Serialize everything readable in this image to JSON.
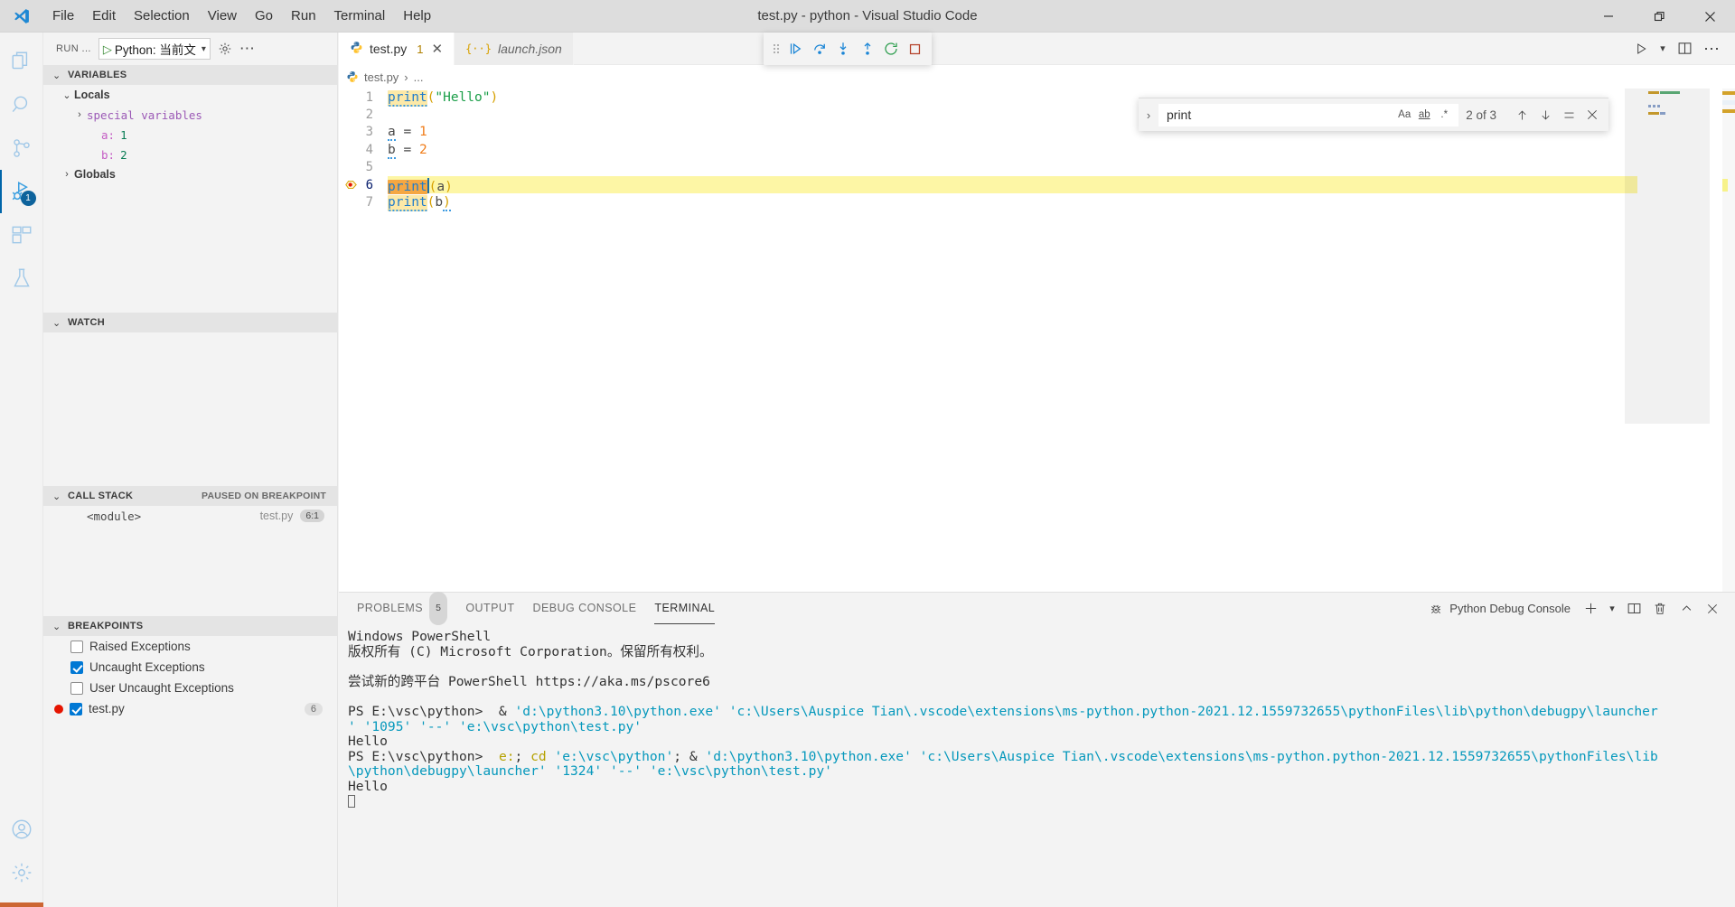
{
  "window": {
    "title": "test.py - python - Visual Studio Code",
    "controls": {
      "minimize": "minimize-icon",
      "maximize": "restore-icon",
      "close": "close-icon"
    }
  },
  "menubar": {
    "items": [
      "File",
      "Edit",
      "Selection",
      "View",
      "Go",
      "Run",
      "Terminal",
      "Help"
    ]
  },
  "activitybar": {
    "items": [
      {
        "name": "explorer",
        "icon": "files-icon",
        "active": false
      },
      {
        "name": "search",
        "icon": "search-icon",
        "active": false
      },
      {
        "name": "source-control",
        "icon": "source-control-icon",
        "active": false
      },
      {
        "name": "run-and-debug",
        "icon": "run-debug-icon",
        "active": true,
        "badge": "1"
      },
      {
        "name": "extensions",
        "icon": "extensions-icon",
        "active": false
      },
      {
        "name": "testing",
        "icon": "beaker-icon",
        "active": false
      }
    ],
    "bottom": [
      {
        "name": "accounts",
        "icon": "account-icon"
      },
      {
        "name": "manage",
        "icon": "gear-icon"
      }
    ]
  },
  "sidebar": {
    "title": "RUN ...",
    "config_label": "Python: 当前文",
    "config_play_icon": "play-icon",
    "config_chevron": "chevron-down-icon",
    "gear_icon": "gear-icon",
    "more_icon": "ellipsis-icon",
    "variables": {
      "header": "VARIABLES",
      "rows": [
        {
          "indent": 1,
          "twisty": "⌄",
          "label": "Locals",
          "kind": "scope"
        },
        {
          "indent": 2,
          "twisty": "›",
          "label": "special variables",
          "kind": "special"
        },
        {
          "indent": 3,
          "twisty": "",
          "name": "a:",
          "value": "1",
          "kind": "var"
        },
        {
          "indent": 3,
          "twisty": "",
          "name": "b:",
          "value": "2",
          "kind": "var"
        },
        {
          "indent": 1,
          "twisty": "›",
          "label": "Globals",
          "kind": "scope"
        }
      ]
    },
    "watch": {
      "header": "WATCH",
      "rows": []
    },
    "callstack": {
      "header": "CALL STACK",
      "status": "PAUSED ON BREAKPOINT",
      "rows": [
        {
          "name": "<module>",
          "file": "test.py",
          "position": "6:1"
        }
      ]
    },
    "breakpoints": {
      "header": "BREAKPOINTS",
      "rows": [
        {
          "label": "Raised Exceptions",
          "checked": false,
          "dot": false,
          "line": ""
        },
        {
          "label": "Uncaught Exceptions",
          "checked": true,
          "dot": false,
          "line": ""
        },
        {
          "label": "User Uncaught Exceptions",
          "checked": false,
          "dot": false,
          "line": ""
        },
        {
          "label": "test.py",
          "checked": true,
          "dot": true,
          "line": "6"
        }
      ]
    }
  },
  "editor": {
    "tabs": [
      {
        "label": "test.py",
        "icon": "python-icon",
        "active": true,
        "warnings": "1",
        "close": "✕",
        "italic": false
      },
      {
        "label": "launch.json",
        "icon": "json-icon",
        "active": false,
        "warnings": "",
        "close": "",
        "italic": true
      }
    ],
    "tab_actions": [
      {
        "name": "run-python-file",
        "icon": "play-icon"
      },
      {
        "name": "run-options",
        "icon": "chevron-down-icon"
      },
      {
        "name": "split-editor",
        "icon": "split-editor-icon"
      },
      {
        "name": "more-actions",
        "icon": "ellipsis-icon"
      }
    ],
    "breadcrumbs": [
      "test.py",
      "..."
    ],
    "breadcrumb_icon": "python-icon",
    "code_lines": [
      {
        "n": "1",
        "tokens": [
          {
            "t": "print",
            "c": "fn",
            "hit": true,
            "squiggle": true
          },
          {
            "t": "(",
            "c": "paren"
          },
          {
            "t": "\"Hello\"",
            "c": "str"
          },
          {
            "t": ")",
            "c": "paren"
          }
        ]
      },
      {
        "n": "2",
        "tokens": []
      },
      {
        "n": "3",
        "tokens": [
          {
            "t": "a",
            "c": "var",
            "squiggle": true
          },
          {
            "t": " = ",
            "c": "op"
          },
          {
            "t": "1",
            "c": "num"
          }
        ]
      },
      {
        "n": "4",
        "tokens": [
          {
            "t": "b",
            "c": "var",
            "squiggle": true
          },
          {
            "t": " = ",
            "c": "op"
          },
          {
            "t": "2",
            "c": "num"
          }
        ]
      },
      {
        "n": "5",
        "tokens": []
      },
      {
        "n": "6",
        "current": true,
        "breakpoint": true,
        "tokens": [
          {
            "t": "print",
            "c": "fn",
            "current_hit": true
          },
          {
            "t": "(",
            "c": "paren"
          },
          {
            "t": "a",
            "c": "var"
          },
          {
            "t": ")",
            "c": "paren"
          }
        ]
      },
      {
        "n": "7",
        "tokens": [
          {
            "t": "print",
            "c": "fn",
            "hit": true,
            "squiggle": true
          },
          {
            "t": "(",
            "c": "paren"
          },
          {
            "t": "b",
            "c": "var"
          },
          {
            "t": ")",
            "c": "paren",
            "squiggle": true
          }
        ]
      }
    ]
  },
  "debug_toolbar": {
    "grip_icon": "drag-grip-icon",
    "buttons": [
      {
        "name": "continue",
        "icon": "continue-icon",
        "title": "Continue"
      },
      {
        "name": "step-over",
        "icon": "step-over-icon",
        "title": "Step Over"
      },
      {
        "name": "step-into",
        "icon": "step-into-icon",
        "title": "Step Into"
      },
      {
        "name": "step-out",
        "icon": "step-out-icon",
        "title": "Step Out"
      },
      {
        "name": "restart",
        "icon": "restart-icon",
        "title": "Restart"
      },
      {
        "name": "stop",
        "icon": "stop-icon",
        "title": "Stop"
      }
    ]
  },
  "find_widget": {
    "toggle_icon": "chevron-right-icon",
    "query": "print",
    "placeholder": "Find",
    "options": [
      {
        "name": "match-case",
        "label": "Aa"
      },
      {
        "name": "match-whole-word",
        "label": "ab"
      },
      {
        "name": "use-regex",
        "label": ".*"
      }
    ],
    "match_count": "2 of 3",
    "actions": [
      {
        "name": "previous-match",
        "icon": "arrow-up-icon"
      },
      {
        "name": "next-match",
        "icon": "arrow-down-icon"
      },
      {
        "name": "find-in-selection",
        "icon": "selection-icon"
      },
      {
        "name": "close-find",
        "icon": "close-icon"
      }
    ]
  },
  "panel": {
    "tabs": [
      {
        "label": "PROBLEMS",
        "badge": "5",
        "active": false
      },
      {
        "label": "OUTPUT",
        "badge": "",
        "active": false
      },
      {
        "label": "DEBUG CONSOLE",
        "badge": "",
        "active": false
      },
      {
        "label": "TERMINAL",
        "badge": "",
        "active": true
      }
    ],
    "terminal_name": "Python Debug Console",
    "terminal_icon": "debug-console-icon",
    "actions": [
      {
        "name": "new-terminal",
        "icon": "plus-icon"
      },
      {
        "name": "terminal-dropdown",
        "icon": "chevron-down-icon"
      },
      {
        "name": "split-terminal",
        "icon": "split-icon"
      },
      {
        "name": "kill-terminal",
        "icon": "trash-icon"
      },
      {
        "name": "maximize-panel",
        "icon": "chevron-up-icon"
      },
      {
        "name": "close-panel",
        "icon": "close-icon"
      }
    ],
    "terminal_lines": [
      [
        {
          "t": "Windows PowerShell",
          "c": ""
        }
      ],
      [
        {
          "t": "版权所有 (C) Microsoft Corporation。保留所有权利。",
          "c": ""
        }
      ],
      [
        {
          "t": "",
          "c": ""
        }
      ],
      [
        {
          "t": "尝试新的跨平台 PowerShell https://aka.ms/pscore6",
          "c": ""
        }
      ],
      [
        {
          "t": "",
          "c": ""
        }
      ],
      [
        {
          "t": "PS E:\\vsc\\python>  & ",
          "c": ""
        },
        {
          "t": "'d:\\python3.10\\python.exe' 'c:\\Users\\Auspice Tian\\.vscode\\extensions\\ms-python.python-2021.12.1559732655\\pythonFiles\\lib\\python\\debugpy\\launcher",
          "c": "cyan"
        }
      ],
      [
        {
          "t": "' '1095' '--' 'e:\\vsc\\python\\test.py'",
          "c": "cyan"
        }
      ],
      [
        {
          "t": "Hello",
          "c": ""
        }
      ],
      [
        {
          "t": "PS E:\\vsc\\python>  ",
          "c": ""
        },
        {
          "t": "e:",
          "c": "yellow"
        },
        {
          "t": "; ",
          "c": ""
        },
        {
          "t": "cd",
          "c": "yellow"
        },
        {
          "t": " 'e:\\vsc\\python'",
          "c": "cyan"
        },
        {
          "t": "; & ",
          "c": ""
        },
        {
          "t": "'d:\\python3.10\\python.exe' 'c:\\Users\\Auspice Tian\\.vscode\\extensions\\ms-python.python-2021.12.1559732655\\pythonFiles\\lib",
          "c": "cyan"
        }
      ],
      [
        {
          "t": "\\python\\debugpy\\launcher' '1324' '--' 'e:\\vsc\\python\\test.py'",
          "c": "cyan"
        }
      ],
      [
        {
          "t": "Hello",
          "c": ""
        }
      ]
    ],
    "cursor": "█"
  },
  "colors": {
    "accent": "#0065a9",
    "activity_icon": "#a0c8e8",
    "breakpoint_red": "#e51400",
    "current_line": "#fdf6a5",
    "find_current": "#f5a742",
    "find_match": "#fce9a8",
    "terminal_cyan": "#0598bc",
    "terminal_yellow": "#b5a100",
    "title_bar": "#dddddd"
  }
}
